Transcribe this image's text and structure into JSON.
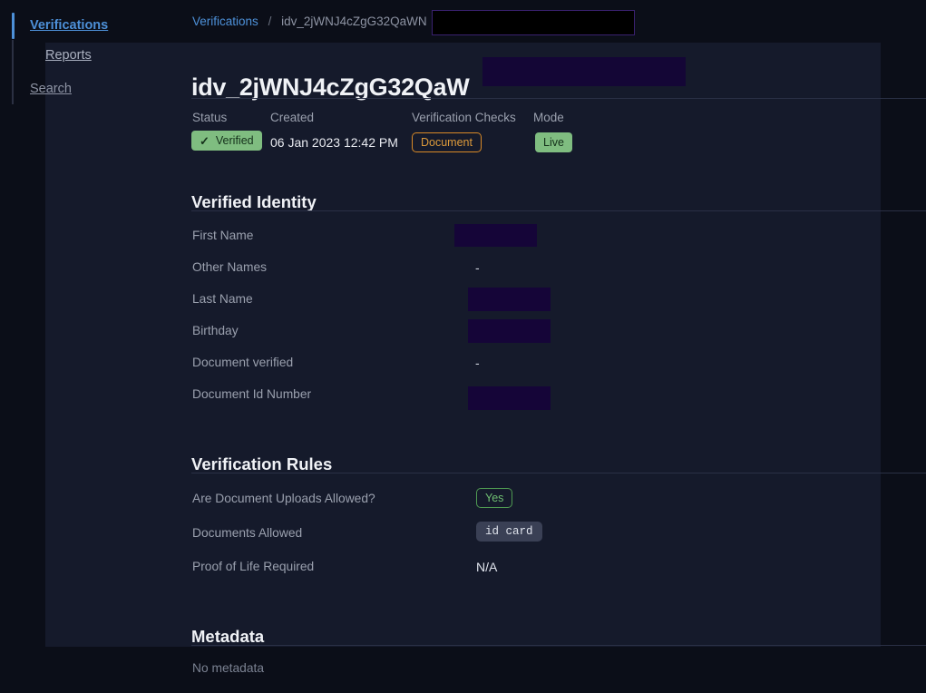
{
  "sidebar": {
    "items": [
      {
        "label": "Verifications",
        "state": "active"
      },
      {
        "label": "Reports",
        "state": "default"
      },
      {
        "label": "Search",
        "state": "default"
      }
    ],
    "accent_color": "#4d90d8"
  },
  "breadcrumb": {
    "root_label": "Verifications",
    "separator": "/",
    "current_label": "idv_2jWNJ4cZgG32QaWN"
  },
  "header": {
    "title": "idv_2jWNJ4cZgG32QaW"
  },
  "summary": {
    "fields": [
      {
        "label": "Status",
        "value": "Verified",
        "kind": "badge-solid-green",
        "icon": "check-icon"
      },
      {
        "label": "Created",
        "value": "06 Jan 2023 12:42 PM",
        "kind": "text"
      },
      {
        "label": "Verification Checks",
        "value": "Document",
        "kind": "badge-outline-orange"
      },
      {
        "label": "Mode",
        "value": "Live",
        "kind": "badge-solid-green"
      }
    ]
  },
  "sections": [
    {
      "title": "Verified Identity",
      "rows": [
        {
          "label": "First Name",
          "value": "",
          "kind": "redacted"
        },
        {
          "label": "Other Names",
          "value": "-",
          "kind": "text"
        },
        {
          "label": "Last Name",
          "value": "",
          "kind": "redacted"
        },
        {
          "label": "Birthday",
          "value": "",
          "kind": "redacted"
        },
        {
          "label": "Document verified",
          "value": "-",
          "kind": "text"
        },
        {
          "label": "Document Id Number",
          "value": "",
          "kind": "redacted"
        }
      ]
    },
    {
      "title": "Verification Rules",
      "rows": [
        {
          "label": "Are Document Uploads Allowed?",
          "value": "Yes",
          "kind": "badge-outline-green"
        },
        {
          "label": "Documents Allowed",
          "value": "id card",
          "kind": "chip-code"
        },
        {
          "label": "Proof of Life Required",
          "value": "N/A",
          "kind": "text"
        }
      ]
    },
    {
      "title": "Metadata",
      "empty_text": "No metadata",
      "rows": []
    }
  ],
  "colors": {
    "page_background": "#0b0e18",
    "panel_background": "#151a2b",
    "accent_blue": "#4d90d8",
    "status_green": "#7fbd80",
    "check_orange": "#d98a27",
    "redaction_purple": "#150538",
    "redaction_black": "#000000",
    "divider": "#2a3045"
  }
}
